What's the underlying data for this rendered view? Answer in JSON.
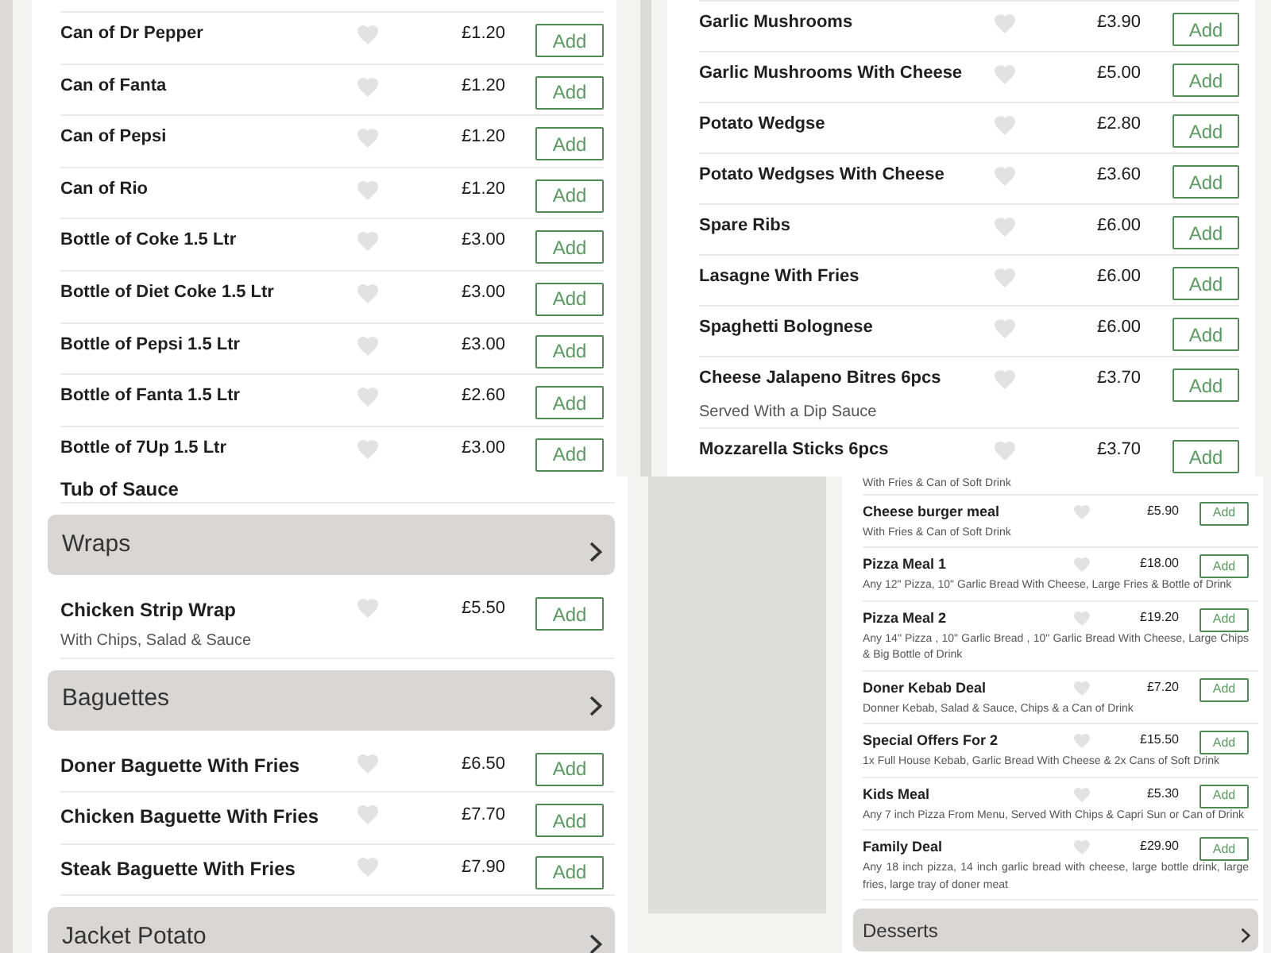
{
  "panels": [
    {
      "kind": "list",
      "entries": [
        {
          "kind": "item",
          "name": "Can of Dr Pepper",
          "favorite": false,
          "price": "£1.20",
          "action": "Add"
        },
        {
          "kind": "item",
          "name": "Can of Fanta",
          "favorite": false,
          "price": "£1.20",
          "action": "Add"
        },
        {
          "kind": "item",
          "name": "Can of Pepsi",
          "favorite": false,
          "price": "£1.20",
          "action": "Add"
        },
        {
          "kind": "item",
          "name": "Can of Rio",
          "favorite": false,
          "price": "£1.20",
          "action": "Add"
        },
        {
          "kind": "item",
          "name": "Bottle of Coke 1.5 Ltr",
          "favorite": false,
          "price": "£3.00",
          "action": "Add"
        },
        {
          "kind": "item",
          "name": "Bottle of Diet Coke 1.5 Ltr",
          "favorite": false,
          "price": "£3.00",
          "action": "Add"
        },
        {
          "kind": "item",
          "name": "Bottle of Pepsi 1.5 Ltr",
          "favorite": false,
          "price": "£3.00",
          "action": "Add"
        },
        {
          "kind": "item",
          "name": "Bottle of Fanta 1.5 Ltr",
          "favorite": false,
          "price": "£2.60",
          "action": "Add"
        },
        {
          "kind": "item",
          "name": "Bottle of 7Up 1.5 Ltr",
          "favorite": false,
          "price": "£3.00",
          "action": "Add"
        }
      ]
    },
    {
      "kind": "list",
      "entries": [
        {
          "kind": "item",
          "name": "Garlic Mushrooms",
          "favorite": false,
          "price": "£3.90",
          "action": "Add"
        },
        {
          "kind": "item",
          "name": "Garlic Mushrooms With Cheese",
          "favorite": false,
          "price": "£5.00",
          "action": "Add"
        },
        {
          "kind": "item",
          "name": "Potato Wedgse",
          "favorite": false,
          "price": "£2.80",
          "action": "Add"
        },
        {
          "kind": "item",
          "name": "Potato Wedgses With Cheese",
          "favorite": false,
          "price": "£3.60",
          "action": "Add"
        },
        {
          "kind": "item",
          "name": "Spare Ribs",
          "favorite": false,
          "price": "£6.00",
          "action": "Add"
        },
        {
          "kind": "item",
          "name": "Lasagne With Fries",
          "favorite": false,
          "price": "£6.00",
          "action": "Add"
        },
        {
          "kind": "item",
          "name": "Spaghetti Bolognese",
          "favorite": false,
          "price": "£6.00",
          "action": "Add"
        },
        {
          "kind": "item",
          "name": "Cheese Jalapeno Bitres 6pcs",
          "favorite": false,
          "price": "£3.70",
          "action": "Add",
          "description": "Served With a Dip Sauce"
        },
        {
          "kind": "item",
          "name": "Mozzarella Sticks 6pcs",
          "favorite": false,
          "price": "£3.70",
          "action": "Add"
        }
      ]
    },
    {
      "kind": "list",
      "entries": [
        {
          "kind": "tail",
          "name": "Tub of Sauce"
        },
        {
          "kind": "category",
          "title": "Wraps"
        },
        {
          "kind": "item",
          "name": "Chicken Strip Wrap",
          "favorite": false,
          "price": "£5.50",
          "action": "Add",
          "description": "With Chips, Salad & Sauce"
        },
        {
          "kind": "category",
          "title": "Baguettes"
        },
        {
          "kind": "item",
          "name": "Doner Baguette With Fries",
          "favorite": false,
          "price": "£6.50",
          "action": "Add"
        },
        {
          "kind": "item",
          "name": "Chicken Baguette With Fries",
          "favorite": false,
          "price": "£7.70",
          "action": "Add"
        },
        {
          "kind": "item",
          "name": "Steak Baguette With Fries",
          "favorite": false,
          "price": "£7.90",
          "action": "Add"
        },
        {
          "kind": "category",
          "title": "Jacket Potato"
        }
      ]
    },
    {
      "kind": "list_with_sidebar",
      "entries": [
        {
          "kind": "tail",
          "description": "With Fries & Can of Soft Drink"
        },
        {
          "kind": "item",
          "name": "Cheese burger meal",
          "favorite": false,
          "price": "£5.90",
          "action": "Add",
          "description": "With Fries & Can of Soft Drink"
        },
        {
          "kind": "item",
          "name": "Pizza Meal 1",
          "favorite": false,
          "price": "£18.00",
          "action": "Add",
          "description": "Any 12\" Pizza, 10\" Garlic Bread With Cheese, Large Fries & Bottle of Drink"
        },
        {
          "kind": "item",
          "name": "Pizza Meal 2",
          "favorite": false,
          "price": "£19.20",
          "action": "Add",
          "description": "Any 14\" Pizza , 10\" Garlic Bread , 10\" Garlic Bread With Cheese, Large Chips & Big Bottle of Drink"
        },
        {
          "kind": "item",
          "name": "Doner Kebab Deal",
          "favorite": false,
          "price": "£7.20",
          "action": "Add",
          "description": "Donner Kebab, Salad & Sauce, Chips & a Can of Drink"
        },
        {
          "kind": "item",
          "name": "Special Offers For 2",
          "favorite": false,
          "price": "£15.50",
          "action": "Add",
          "description": "1x Full House Kebab, Garlic Bread With Cheese & 2x Cans of Soft Drink"
        },
        {
          "kind": "item",
          "name": "Kids Meal",
          "favorite": false,
          "price": "£5.30",
          "action": "Add",
          "description": "Any 7 inch Pizza From Menu, Served With Chips & Capri Sun or Can of Drink"
        },
        {
          "kind": "item",
          "name": "Family Deal",
          "favorite": false,
          "price": "£29.90",
          "action": "Add",
          "description": "Any 18 inch pizza, 14 inch garlic bread with cheese, large bottle drink, large fries, large tray of doner meat"
        },
        {
          "kind": "category",
          "title": "Desserts"
        }
      ]
    }
  ]
}
